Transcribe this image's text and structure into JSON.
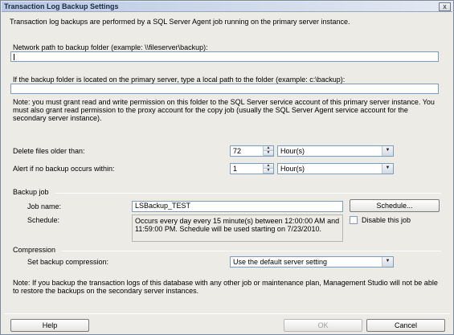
{
  "window": {
    "title": "Transaction Log Backup Settings",
    "close_glyph": "x"
  },
  "intro": "Transaction log backups are performed by a SQL Server Agent job running on the primary server instance.",
  "network_path": {
    "label": "Network path to backup folder (example: \\\\fileserver\\backup):",
    "value": ""
  },
  "local_path": {
    "label": "If the backup folder is located on the primary server, type a local path to the folder (example: c:\\backup):",
    "value": ""
  },
  "note_permissions": "Note: you must grant read and write permission on this folder to the SQL Server service account of this primary server instance. You must also grant read permission to the proxy account for the copy job (usually the SQL Server Agent service account for the secondary server instance).",
  "delete_files": {
    "label": "Delete files older than:",
    "value": "72",
    "unit": "Hour(s)"
  },
  "alert": {
    "label": "Alert if no backup occurs within:",
    "value": "1",
    "unit": "Hour(s)"
  },
  "backup_job": {
    "group_label": "Backup job",
    "job_name_label": "Job name:",
    "job_name_value": "LSBackup_TEST",
    "schedule_button": "Schedule...",
    "schedule_label": "Schedule:",
    "schedule_text": "Occurs every day every 15 minute(s) between 12:00:00 AM and 11:59:00 PM. Schedule will be used starting on 7/23/2010.",
    "disable_label": "Disable this job",
    "disable_checked": false
  },
  "compression": {
    "group_label": "Compression",
    "label": "Set backup compression:",
    "value": "Use the default server setting"
  },
  "note_bottom": "Note: If you backup the transaction logs of this database with any other job or maintenance plan, Management Studio will not be able to restore the backups on the secondary server instances.",
  "buttons": {
    "help": "Help",
    "ok": "OK",
    "cancel": "Cancel"
  },
  "glyphs": {
    "spin_up": "▲",
    "spin_down": "▼",
    "dropdown": "▼"
  }
}
